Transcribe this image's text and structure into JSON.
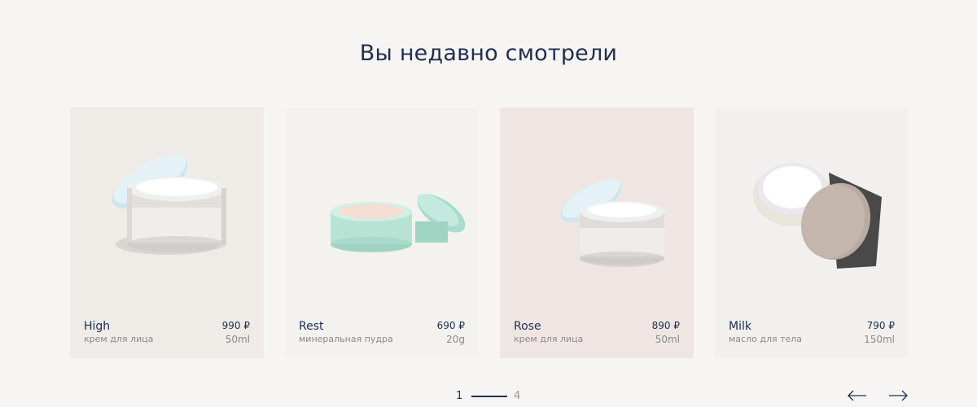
{
  "section": {
    "title": "Вы недавно смотрели"
  },
  "products": [
    {
      "name": "High",
      "subtitle": "крем для лица",
      "price": "990 ₽",
      "volume": "50ml",
      "image_icon": "cream-jar-icon"
    },
    {
      "name": "Rest",
      "subtitle": "минеральная пудра",
      "price": "690 ₽",
      "volume": "20g",
      "image_icon": "powder-jar-icon"
    },
    {
      "name": "Rose",
      "subtitle": "крем для лица",
      "price": "890 ₽",
      "volume": "50ml",
      "image_icon": "cream-jar-icon"
    },
    {
      "name": "Milk",
      "subtitle": "масло для тела",
      "price": "790 ₽",
      "volume": "150ml",
      "image_icon": "body-butter-jar-icon"
    }
  ],
  "pagination": {
    "current": "1",
    "total": "4"
  },
  "navigation": {
    "prev_icon": "arrow-left-icon",
    "next_icon": "arrow-right-icon"
  },
  "colors": {
    "accent": "#1f2f4f",
    "background": "#f7f5f3"
  }
}
